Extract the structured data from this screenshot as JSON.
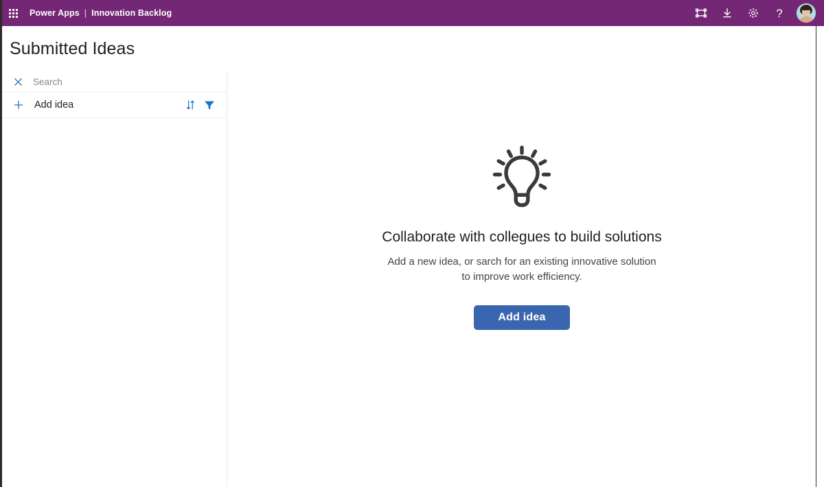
{
  "topbar": {
    "waffle_icon": "app-launcher-waffle-icon",
    "brand": "Power Apps",
    "separator": "|",
    "app_name": "Innovation Backlog",
    "actions": [
      {
        "name": "fit-to-screen-icon",
        "label": "Fit to screen"
      },
      {
        "name": "download-icon",
        "label": "Download"
      },
      {
        "name": "settings-gear-icon",
        "label": "Settings"
      },
      {
        "name": "help-icon",
        "label": "?"
      }
    ],
    "avatar_label": "Account manager"
  },
  "header": {
    "title": "Submitted Ideas"
  },
  "sidebar": {
    "search": {
      "clear_icon": "close-x-icon",
      "placeholder": "Search",
      "value": ""
    },
    "add_idea": {
      "plus_icon": "plus-icon",
      "label": "Add idea"
    },
    "sort_icon": "sort-arrows-icon",
    "filter_icon": "filter-funnel-icon",
    "items": []
  },
  "main": {
    "illustration": "lightbulb-icon",
    "title": "Collaborate with collegues to build solutions",
    "subtitle": "Add a new idea, or sarch for an existing innovative solution to improve work efficiency.",
    "primary_button": "Add idea"
  },
  "colors": {
    "brand_purple": "#742774",
    "accent_blue": "#1a73c4",
    "button_blue": "#3a66b0",
    "text_primary": "#201f1e",
    "text_secondary": "#444240"
  }
}
